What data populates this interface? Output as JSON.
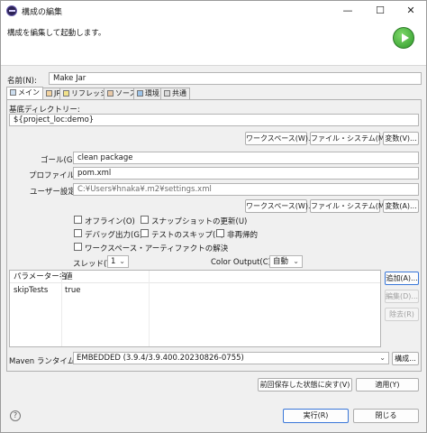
{
  "window": {
    "title": "構成の編集",
    "minimize": "—",
    "maximize": "☐",
    "close": "✕"
  },
  "header": {
    "description": "構成を編集して起動します。"
  },
  "name": {
    "label": "名前(N):",
    "value": "Make Jar"
  },
  "tabs": [
    {
      "label": "メイン",
      "active": true
    },
    {
      "label": "JRE"
    },
    {
      "label": "リフレッシュ"
    },
    {
      "label": "ソース"
    },
    {
      "label": "環境"
    },
    {
      "label": "共通"
    }
  ],
  "main": {
    "base_dir_label": "基底ディレクトリー:",
    "base_dir_value": "${project_loc:demo}",
    "workspace_button": "ワークスペース(W)...",
    "filesystem_button": "ファイル・システム(M)...",
    "variables_button": "変数(V)...",
    "goals_label": "ゴール(G):",
    "goals_value": "clean package",
    "profiles_label": "プロファイル(P):",
    "profiles_value": "pom.xml",
    "user_settings_label": "ユーザー設定:",
    "user_settings_value": "C:¥Users¥hnaka¥.m2¥settings.xml",
    "workspace_button2": "ワークスペース(W)...",
    "filesystem_button2": "ファイル・システム(M)...",
    "variables_button2": "変数(A)...",
    "checkboxes": {
      "offline": "オフライン(O)",
      "update_snapshots": "スナップショットの更新(U)",
      "debug_output": "デバッグ出力(G)",
      "skip_tests": "テストのスキップ(K)",
      "non_recursive": "非再帰的",
      "resolve_workspace": "ワークスペース・アーティファクトの解決"
    },
    "threads_label": "スレッド(T):",
    "threads_value": "1",
    "color_output_label": "Color Output(C):",
    "color_output_value": "自動",
    "params": {
      "headers": [
        "パラメーター名",
        "値"
      ],
      "rows": [
        [
          "skipTests",
          "true"
        ]
      ]
    },
    "add_button": "追加(A)...",
    "edit_button": "編集(D)...",
    "remove_button": "除去(R)",
    "maven_runtime_label": "Maven ランタイム(I):",
    "maven_runtime_value": "EMBEDDED (3.9.4/3.9.400.20230826-0755)",
    "configure_button": "構成..."
  },
  "footer": {
    "revert_button": "前回保存した状態に戻す(V)",
    "apply_button": "適用(Y)",
    "run_button": "実行(R)",
    "close_button": "閉じる"
  }
}
